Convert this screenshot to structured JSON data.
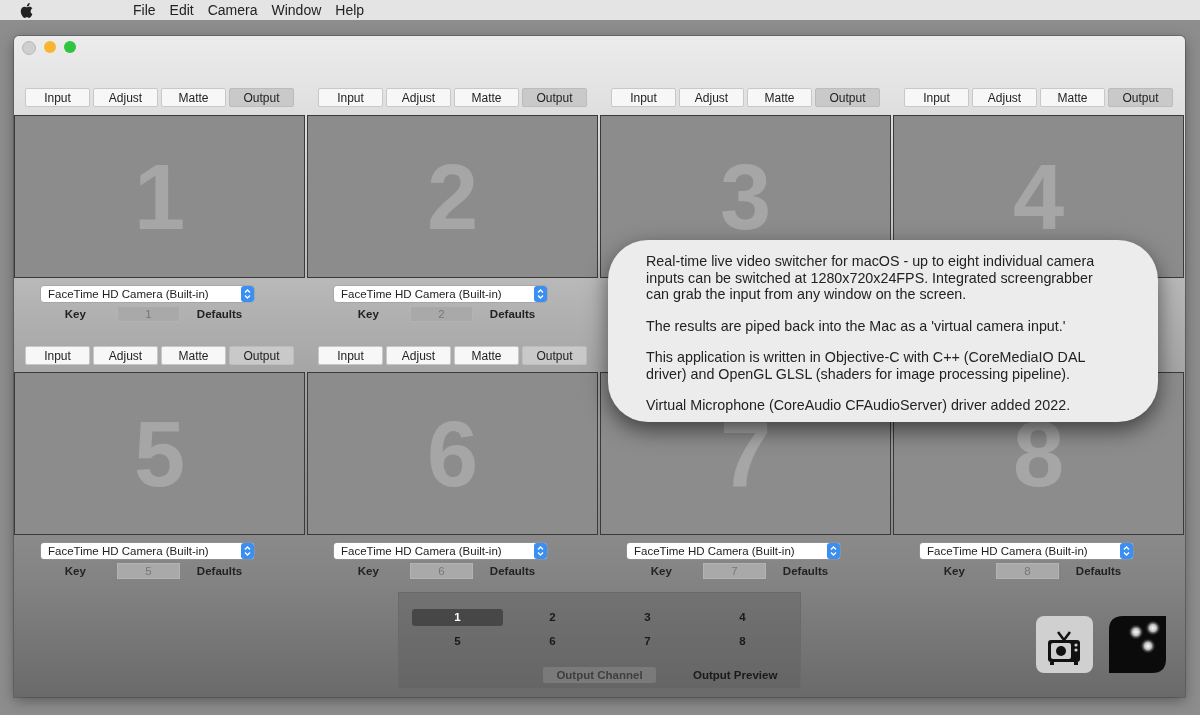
{
  "menu_bar": {
    "items": [
      "File",
      "Edit",
      "Camera",
      "Window",
      "Help"
    ]
  },
  "cells": [
    {
      "number": "1",
      "mode_buttons": [
        {
          "label": "Input",
          "selected": false
        },
        {
          "label": "Adjust",
          "selected": false
        },
        {
          "label": "Matte",
          "selected": false
        },
        {
          "label": "Output",
          "selected": true
        }
      ],
      "camera": "FaceTime HD Camera (Built-in)",
      "key_label": "Key",
      "key_value": "1",
      "defaults_label": "Defaults"
    },
    {
      "number": "2",
      "mode_buttons": [
        {
          "label": "Input",
          "selected": false
        },
        {
          "label": "Adjust",
          "selected": false
        },
        {
          "label": "Matte",
          "selected": false
        },
        {
          "label": "Output",
          "selected": true
        }
      ],
      "camera": "FaceTime HD Camera (Built-in)",
      "key_label": "Key",
      "key_value": "2",
      "defaults_label": "Defaults"
    },
    {
      "number": "3",
      "mode_buttons": [
        {
          "label": "Input",
          "selected": false
        },
        {
          "label": "Adjust",
          "selected": false
        },
        {
          "label": "Matte",
          "selected": false
        },
        {
          "label": "Output",
          "selected": true
        }
      ]
    },
    {
      "number": "4",
      "mode_buttons": [
        {
          "label": "Input",
          "selected": false
        },
        {
          "label": "Adjust",
          "selected": false
        },
        {
          "label": "Matte",
          "selected": false
        },
        {
          "label": "Output",
          "selected": true
        }
      ]
    },
    {
      "number": "5",
      "mode_buttons": [
        {
          "label": "Input",
          "selected": false
        },
        {
          "label": "Adjust",
          "selected": false
        },
        {
          "label": "Matte",
          "selected": false
        },
        {
          "label": "Output",
          "selected": true
        }
      ],
      "camera": "FaceTime HD Camera (Built-in)",
      "key_label": "Key",
      "key_value": "5",
      "defaults_label": "Defaults"
    },
    {
      "number": "6",
      "mode_buttons": [
        {
          "label": "Input",
          "selected": false
        },
        {
          "label": "Adjust",
          "selected": false
        },
        {
          "label": "Matte",
          "selected": false
        },
        {
          "label": "Output",
          "selected": true
        }
      ],
      "camera": "FaceTime HD Camera (Built-in)",
      "key_label": "Key",
      "key_value": "6",
      "defaults_label": "Defaults"
    },
    {
      "number": "7",
      "camera": "FaceTime HD Camera (Built-in)",
      "key_label": "Key",
      "key_value": "7",
      "defaults_label": "Defaults"
    },
    {
      "number": "8",
      "camera": "FaceTime HD Camera (Built-in)",
      "key_label": "Key",
      "key_value": "8",
      "defaults_label": "Defaults"
    }
  ],
  "output_panel": {
    "channels": [
      {
        "label": "1",
        "selected": true
      },
      {
        "label": "2",
        "selected": false
      },
      {
        "label": "3",
        "selected": false
      },
      {
        "label": "4",
        "selected": false
      },
      {
        "label": "5",
        "selected": false
      },
      {
        "label": "6",
        "selected": false
      },
      {
        "label": "7",
        "selected": false
      },
      {
        "label": "8",
        "selected": false
      }
    ],
    "output_channel": {
      "label": "Output Channel",
      "disabled": true
    },
    "output_preview": "Output Preview"
  },
  "callout": {
    "paragraphs": [
      "Real-time live video switcher for macOS - up to eight individual camera inputs can be switched at 1280x720x24FPS.  Integrated screengrabber can grab the input from any window on the screen.",
      "The results are piped back into the Mac as a 'virtual camera input.'",
      "This application is written in Objective-C with C++ (CoreMediaIO DAL driver) and OpenGL GLSL (shaders for image processing pipeline).",
      "Virtual Microphone (CoreAudio CFAudioServer) driver added 2022."
    ]
  }
}
